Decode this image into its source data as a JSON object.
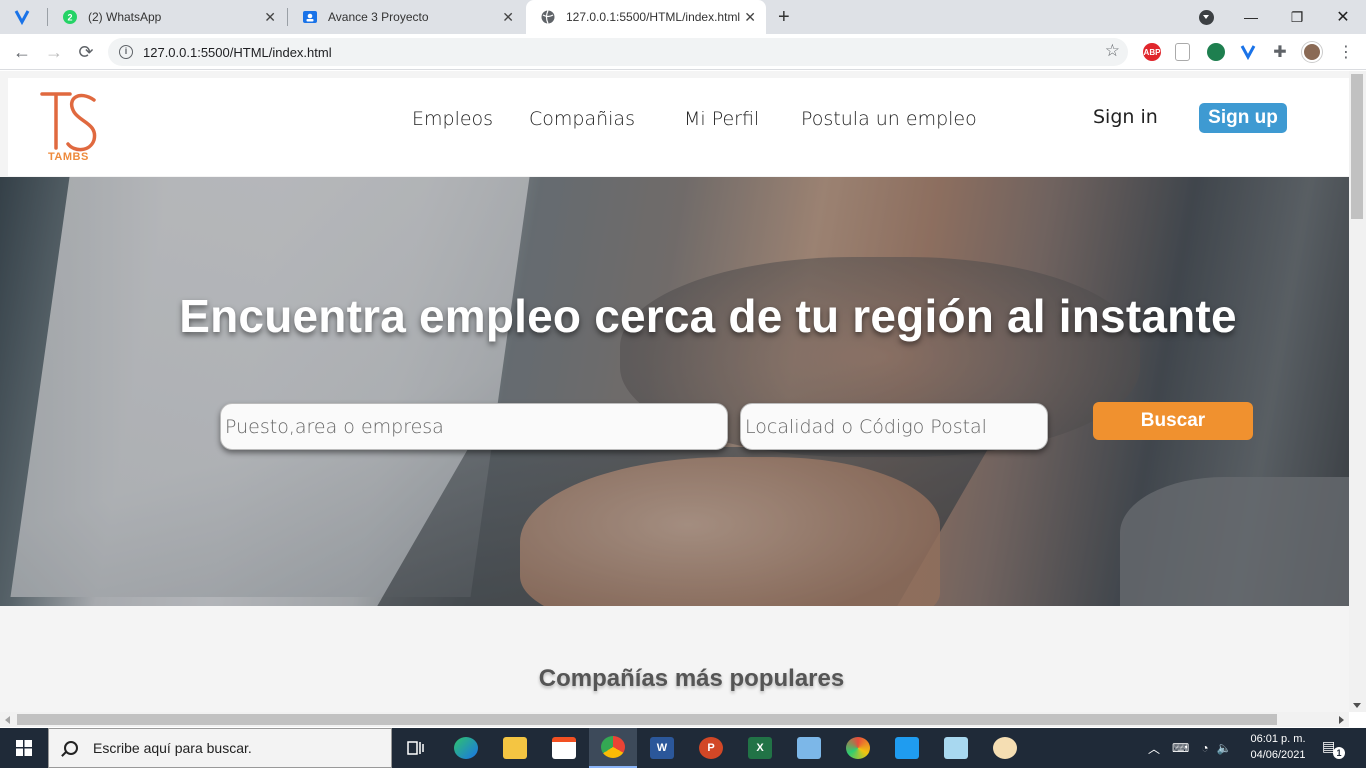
{
  "browser": {
    "tabs": [
      {
        "label": "",
        "icon": "vivaldi-like-y-icon"
      },
      {
        "label": "(2) WhatsApp",
        "badge": "2",
        "icon": "whatsapp-icon"
      },
      {
        "label": "Avance 3 Proyecto",
        "icon": "google-classroom-icon"
      },
      {
        "label": "127.0.0.1:5500/HTML/index.html",
        "icon": "globe-icon",
        "active": true
      }
    ],
    "url": "127.0.0.1:5500/HTML/index.html",
    "extensions": [
      "adblock-icon",
      "shield-icon",
      "extension-green-icon",
      "extension-blue-y-icon",
      "puzzle-icon",
      "profile-avatar"
    ],
    "adblock_label": "ABP"
  },
  "site": {
    "logo_text": "TAMBS",
    "nav": [
      "Empleos",
      "Compañias",
      "Mi Perfil",
      "Postula un empleo"
    ],
    "sign_in": "Sign in",
    "sign_up": "Sign up",
    "hero_title": "Encuentra empleo cerca de tu región al instante",
    "search_placeholder": "Puesto,area o empresa",
    "location_placeholder": "Localidad o Código Postal",
    "search_button": "Buscar",
    "popular_title": "Compañías más populares",
    "colors": {
      "brand_orange": "#f0912f",
      "signup_blue": "#3e9ad2",
      "logo_orange": "#e0693f"
    }
  },
  "taskbar": {
    "search_placeholder": "Escribe aquí para buscar.",
    "apps": [
      "task-view-icon",
      "edge-icon",
      "file-explorer-icon",
      "store-icon",
      "chrome-icon",
      "word-icon",
      "powerpoint-icon",
      "excel-icon",
      "3d-viewer-icon",
      "app-swirl-icon",
      "vscode-icon",
      "notepad-icon",
      "paint-icon"
    ],
    "time": "06:01 p. m.",
    "date": "04/06/2021",
    "notifications": "1"
  }
}
